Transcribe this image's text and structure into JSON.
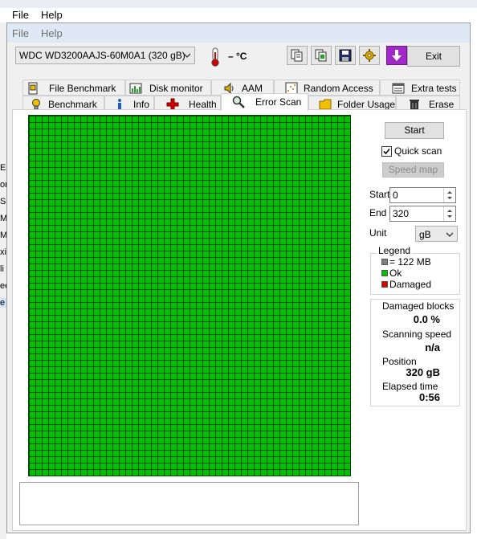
{
  "background_window": {
    "menu": [
      "File",
      "Help"
    ],
    "left_edge_fragments": [
      "Ely",
      "or",
      "S",
      "M",
      "M",
      "xin",
      "li",
      "ee",
      "e"
    ]
  },
  "app": {
    "menu": {
      "file": "File",
      "help": "Help"
    },
    "toolbar": {
      "drive": "WDC WD3200AAJS-60M0A1 (320 gB)",
      "temperature": "– °C",
      "icons": [
        "copy-text-icon",
        "copy-screenshot-icon",
        "save-icon",
        "options-icon",
        "download-arrow-icon"
      ],
      "exit_label": "Exit"
    },
    "tabs_row1": [
      {
        "label": "File Benchmark",
        "icon": "file-benchmark-icon"
      },
      {
        "label": "Disk monitor",
        "icon": "disk-monitor-icon"
      },
      {
        "label": "AAM",
        "icon": "speaker-icon"
      },
      {
        "label": "Random Access",
        "icon": "random-access-icon"
      },
      {
        "label": "Extra tests",
        "icon": "extra-tests-icon"
      }
    ],
    "tabs_row2": [
      {
        "label": "Benchmark",
        "icon": "benchmark-icon"
      },
      {
        "label": "Info",
        "icon": "info-icon"
      },
      {
        "label": "Health",
        "icon": "health-cross-icon"
      },
      {
        "label": "Error Scan",
        "icon": "magnifier-icon",
        "active": true
      },
      {
        "label": "Folder Usage",
        "icon": "folder-icon"
      },
      {
        "label": "Erase",
        "icon": "trash-icon"
      }
    ],
    "scan_panel": {
      "start_label": "Start",
      "quick_scan_label": "Quick scan",
      "quick_scan_checked": true,
      "speed_map_label": "Speed map",
      "start_field_label": "Start",
      "start_value": "0",
      "end_field_label": "End",
      "end_value": "320",
      "unit_label": "Unit",
      "unit_value": "gB",
      "legend": {
        "title": "Legend",
        "items": [
          {
            "label": "= 122 MB",
            "color": "#808080"
          },
          {
            "label": "Ok",
            "color": "#00c000"
          },
          {
            "label": "Damaged",
            "color": "#e00000"
          }
        ]
      },
      "stats": {
        "damaged_blocks_label": "Damaged blocks",
        "damaged_blocks_value": "0.0 %",
        "scanning_speed_label": "Scanning speed",
        "scanning_speed_value": "n/a",
        "position_label": "Position",
        "position_value": "320 gB",
        "elapsed_label": "Elapsed time",
        "elapsed_value": "0:56"
      },
      "grid_color": "#00c000",
      "log_text": ""
    }
  }
}
